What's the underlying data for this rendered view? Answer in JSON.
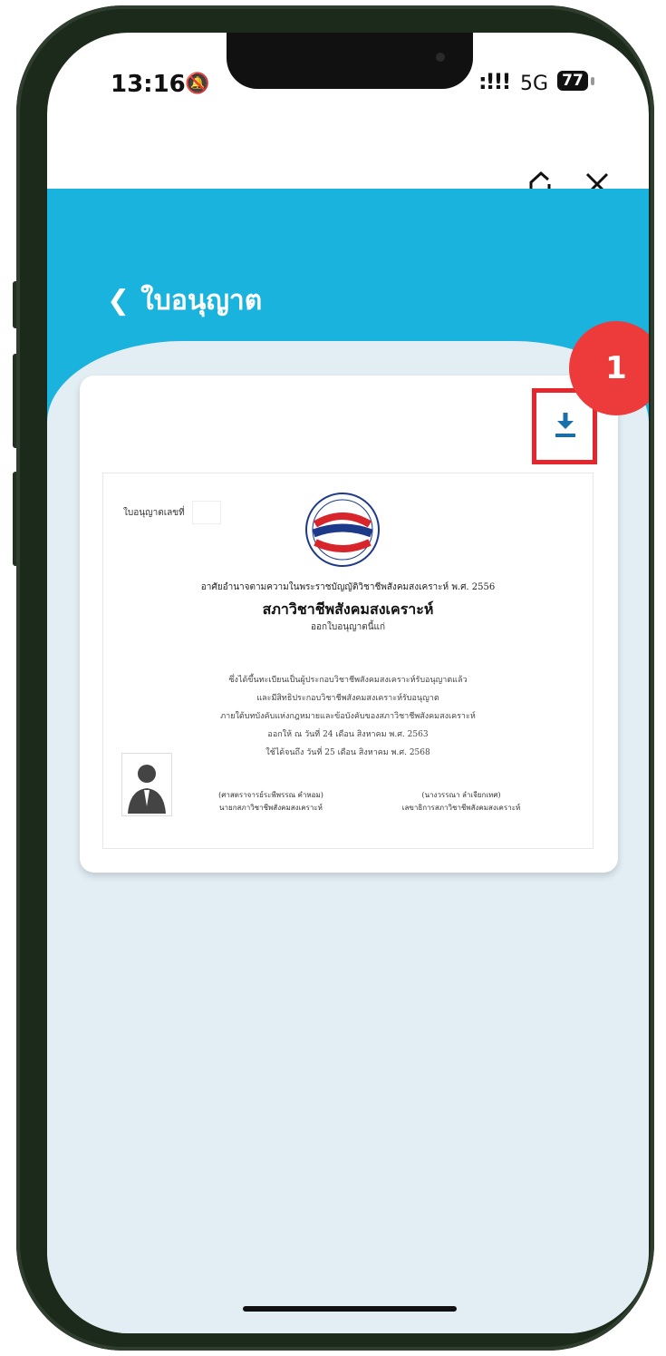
{
  "status_bar": {
    "time": "13:16",
    "silent_icon": "bell-slash-icon",
    "signal": ":!!!",
    "network": "5G",
    "battery": "77"
  },
  "toolbar": {
    "add_icon": "home-add-icon",
    "close_icon": "close-icon"
  },
  "nav": {
    "back_icon": "chevron-left-icon",
    "title": "ใบอนุญาต"
  },
  "card": {
    "download_icon": "download-icon",
    "step_badge": "1"
  },
  "colors": {
    "header": "#19b3dd",
    "sheet": "#e2eef4",
    "highlight": "#e5262d",
    "badge": "#ed3b3b",
    "download": "#1a6fa8"
  },
  "certificate": {
    "license_no_label": "ใบอนุญาตเลขที่",
    "authority_line": "อาศัยอำนาจตามความในพระราชบัญญัติวิชาชีพสังคมสงเคราะห์ พ.ศ. 2556",
    "org_name": "สภาวิชาชีพสังคมสงเคราะห์",
    "issue_line": "ออกใบอนุญาตนี้แก่",
    "body": [
      "ซึ่งได้ขึ้นทะเบียนเป็นผู้ประกอบวิชาชีพสังคมสงเคราะห์รับอนุญาตแล้ว",
      "และมีสิทธิประกอบวิชาชีพสังคมสงเคราะห์รับอนุญาต",
      "ภายใต้บทบังคับแห่งกฎหมายและข้อบังคับของสภาวิชาชีพสังคมสงเคราะห์",
      "ออกให้ ณ วันที่ 24 เดือน สิงหาคม พ.ศ. 2563",
      "ใช้ได้จนถึง วันที่ 25 เดือน สิงหาคม พ.ศ. 2568"
    ],
    "photo_icon": "person-silhouette-icon",
    "signer1_name": "(ศาสตราจารย์ระพีพรรณ คำหอม)",
    "signer1_title": "นายกสภาวิชาชีพสังคมสงเคราะห์",
    "signer2_name": "(นางวรรณา ลำเจียกเทศ)",
    "signer2_title": "เลขาธิการสภาวิชาชีพสังคมสงเคราะห์"
  }
}
